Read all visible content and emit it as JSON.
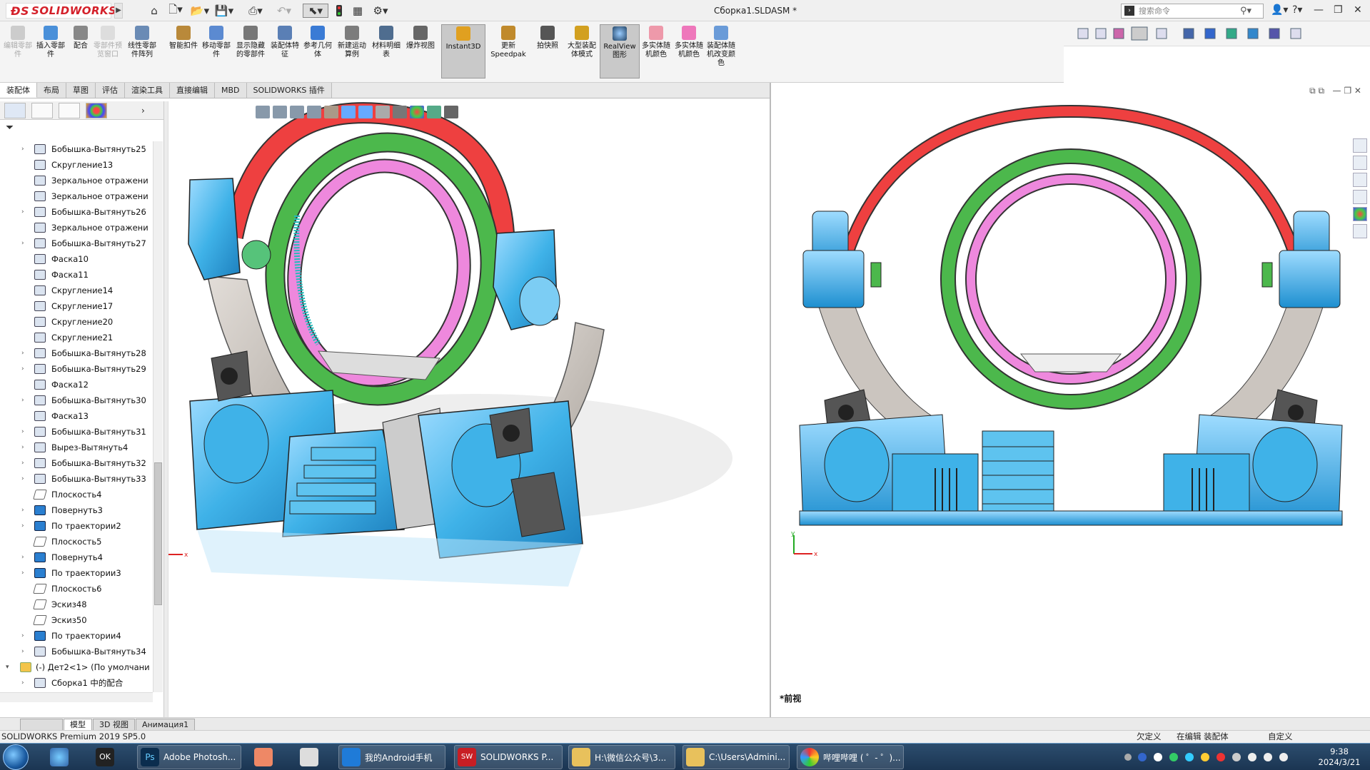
{
  "app": {
    "brand": "SOLIDWORKS",
    "document_title": "Сборка1.SLDASM *",
    "search_placeholder": "搜索命令"
  },
  "ribbon": {
    "buttons": [
      {
        "label": "编辑零部件",
        "state": "disabled"
      },
      {
        "label": "插入零部件"
      },
      {
        "label": "配合"
      },
      {
        "label": "零部件预览窗口",
        "state": "disabled"
      },
      {
        "label": "线性零部件阵列"
      },
      {
        "label": "智能扣件"
      },
      {
        "label": "移动零部件"
      },
      {
        "label": "显示隐藏的零部件"
      },
      {
        "label": "装配体特征"
      },
      {
        "label": "参考几何体"
      },
      {
        "label": "新建运动算例"
      },
      {
        "label": "材料明细表"
      },
      {
        "label": "爆炸视图"
      },
      {
        "label": "Instant3D",
        "state": "active"
      },
      {
        "label": "更新Speedpak"
      },
      {
        "label": "拍快照"
      },
      {
        "label": "大型装配体模式"
      },
      {
        "label": "RealView图形",
        "state": "active"
      },
      {
        "label": "多实体随机颜色"
      },
      {
        "label": "多实体随机颜色"
      },
      {
        "label": "装配体随机改变颜色"
      }
    ]
  },
  "command_tabs": [
    "装配体",
    "布局",
    "草图",
    "评估",
    "渲染工具",
    "直接编辑",
    "MBD",
    "SOLIDWORKS 插件"
  ],
  "feature_tree": {
    "items": [
      {
        "label": "Бобышка-Вытянуть25",
        "expandable": true,
        "icon": "extrude"
      },
      {
        "label": "Скругление13",
        "icon": "fillet"
      },
      {
        "label": "Зеркальное отражени",
        "icon": "mirror"
      },
      {
        "label": "Зеркальное отражени",
        "icon": "mirror"
      },
      {
        "label": "Бобышка-Вытянуть26",
        "expandable": true,
        "icon": "extrude"
      },
      {
        "label": "Зеркальное отражени",
        "icon": "mirror"
      },
      {
        "label": "Бобышка-Вытянуть27",
        "expandable": true,
        "icon": "extrude"
      },
      {
        "label": "Фаска10",
        "icon": "chamfer"
      },
      {
        "label": "Фаска11",
        "icon": "chamfer"
      },
      {
        "label": "Скругление14",
        "icon": "fillet"
      },
      {
        "label": "Скругление17",
        "icon": "fillet"
      },
      {
        "label": "Скругление20",
        "icon": "fillet"
      },
      {
        "label": "Скругление21",
        "icon": "fillet"
      },
      {
        "label": "Бобышка-Вытянуть28",
        "expandable": true,
        "icon": "extrude"
      },
      {
        "label": "Бобышка-Вытянуть29",
        "expandable": true,
        "icon": "extrude"
      },
      {
        "label": "Фаска12",
        "icon": "chamfer"
      },
      {
        "label": "Бобышка-Вытянуть30",
        "expandable": true,
        "icon": "extrude"
      },
      {
        "label": "Фаска13",
        "icon": "chamfer"
      },
      {
        "label": "Бобышка-Вытянуть31",
        "expandable": true,
        "icon": "extrude"
      },
      {
        "label": "Вырез-Вытянуть4",
        "expandable": true,
        "icon": "cut"
      },
      {
        "label": "Бобышка-Вытянуть32",
        "expandable": true,
        "icon": "extrude"
      },
      {
        "label": "Бобышка-Вытянуть33",
        "expandable": true,
        "icon": "extrude"
      },
      {
        "label": "Плоскость4",
        "icon": "plane"
      },
      {
        "label": "Повернуть3",
        "expandable": true,
        "icon": "revolve"
      },
      {
        "label": "По траектории2",
        "expandable": true,
        "icon": "sweep"
      },
      {
        "label": "Плоскость5",
        "icon": "plane"
      },
      {
        "label": "Повернуть4",
        "expandable": true,
        "icon": "revolve"
      },
      {
        "label": "По траектории3",
        "expandable": true,
        "icon": "sweep"
      },
      {
        "label": "Плоскость6",
        "icon": "plane"
      },
      {
        "label": "Эскиз48",
        "icon": "sketch"
      },
      {
        "label": "Эскиз50",
        "icon": "sketch"
      },
      {
        "label": "По траектории4",
        "expandable": true,
        "icon": "sweep"
      },
      {
        "label": "Бобышка-Вытянуть34",
        "expandable": true,
        "icon": "extrude"
      },
      {
        "label": "(-) Дет2<1> (По умолчани",
        "expandable": true,
        "icon": "part",
        "root": true
      },
      {
        "label": "Сборка1 中的配合",
        "expandable": true,
        "icon": "mates"
      }
    ]
  },
  "viewport_right": {
    "view_label": "*前视"
  },
  "bottom_tabs": [
    "模型",
    "3D 视图",
    "Анимация1"
  ],
  "status_bar": {
    "product": "SOLIDWORKS Premium 2019 SP5.0",
    "state1": "欠定义",
    "state2": "在编辑 装配体",
    "state3": "自定义"
  },
  "taskbar": {
    "items": [
      {
        "label": "Adobe Photosh..."
      },
      {
        "label": "我的Android手机"
      },
      {
        "label": "SOLIDWORKS P..."
      },
      {
        "label": "H:\\微信公众号\\3..."
      },
      {
        "label": "C:\\Users\\Admini..."
      },
      {
        "label": "哔哩哔哩 ( ゜- ゜)..."
      }
    ],
    "time": "9:38",
    "date": "2024/3/21"
  },
  "colors": {
    "accent_blue": "#3fb2e8",
    "ring_red": "#ee4040",
    "ring_green": "#4cb84c",
    "ring_pink": "#ee88dd",
    "arm_gray": "#c9c2bc"
  }
}
